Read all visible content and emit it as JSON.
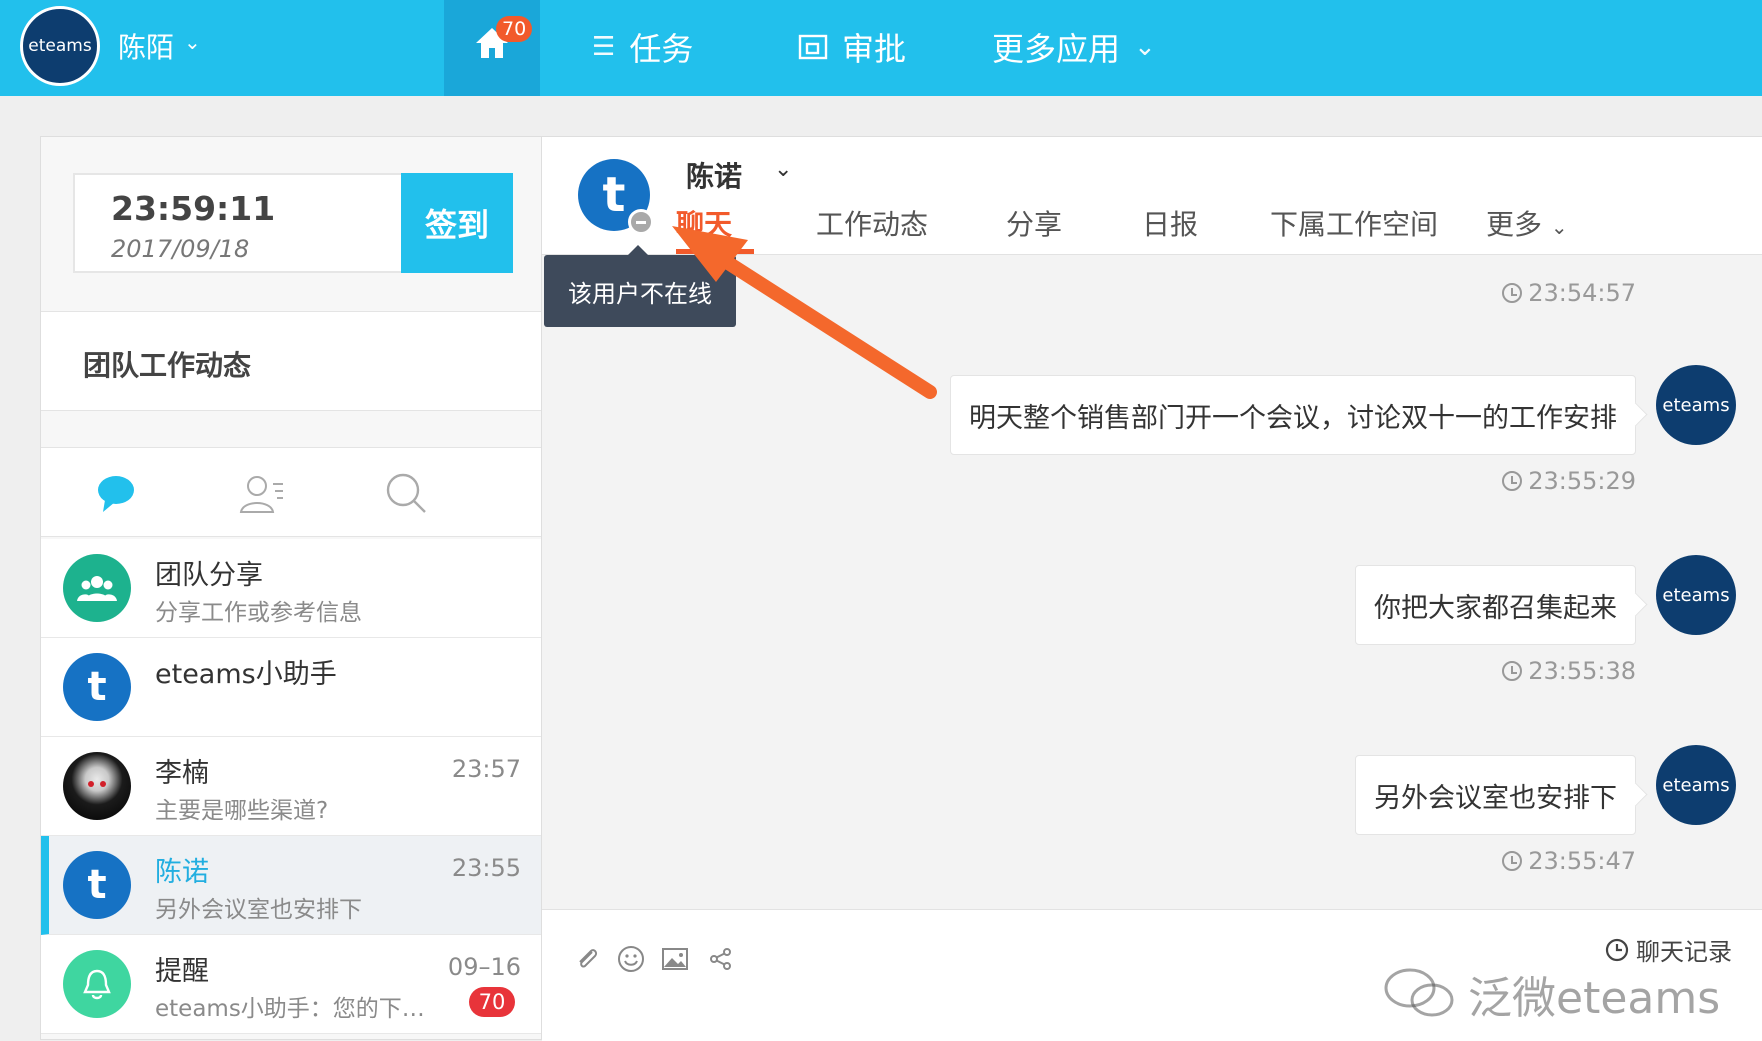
{
  "topbar": {
    "logo_text": "eteams",
    "username": "陈陌",
    "home_badge": "70",
    "nav": [
      {
        "label": "任务",
        "icon": "list-icon"
      },
      {
        "label": "审批",
        "icon": "approval-icon"
      },
      {
        "label": "更多应用",
        "icon": "chevron-down-icon"
      }
    ]
  },
  "left": {
    "clock_time": "23:59:11",
    "clock_date": "2017/09/18",
    "checkin_label": "签到",
    "team_dynamics": "团队工作动态",
    "tabs": [
      "chat-bubble-icon",
      "contacts-icon",
      "search-icon"
    ],
    "conversations": [
      {
        "name": "团队分享",
        "preview": "分享工作或参考信息",
        "time": "",
        "badge": "",
        "avatar": "group-icon",
        "color": "#1db28e"
      },
      {
        "name": "eteams小助手",
        "preview": "",
        "time": "",
        "badge": "",
        "avatar": "t",
        "color": "#1672c4"
      },
      {
        "name": "李楠",
        "preview": "主要是哪些渠道?",
        "time": "23:57",
        "badge": "",
        "avatar": "photo",
        "color": "#2a2a2a"
      },
      {
        "name": "陈诺",
        "preview": "另外会议室也安排下",
        "time": "23:55",
        "badge": "",
        "avatar": "t",
        "color": "#1672c4"
      },
      {
        "name": "提醒",
        "preview": "eteams小助手：您的下…",
        "time": "09–16",
        "badge": "70",
        "avatar": "bell-icon",
        "color": "#3fd6a0"
      }
    ]
  },
  "chat": {
    "contact_name": "陈诺",
    "avatar_letter": "t",
    "tabs": [
      "聊天",
      "工作动态",
      "分享",
      "日报",
      "下属工作空间",
      "更多"
    ],
    "tooltip": "该用户不在线",
    "messages": [
      {
        "text": "",
        "time": "23:54:57"
      },
      {
        "text": "明天整个销售部门开一个会议，讨论双十一的工作安排",
        "time": "23:55:29"
      },
      {
        "text": "你把大家都召集起来",
        "time": "23:55:38"
      },
      {
        "text": "另外会议室也安排下",
        "time": "23:55:47"
      }
    ],
    "sender_avatar_text": "eteams",
    "history_label": "聊天记录",
    "watermark": "泛微eteams"
  },
  "colors": {
    "accent": "#22c0ec",
    "highlight": "#f25a2b",
    "dark_brand": "#0d3d6f"
  }
}
